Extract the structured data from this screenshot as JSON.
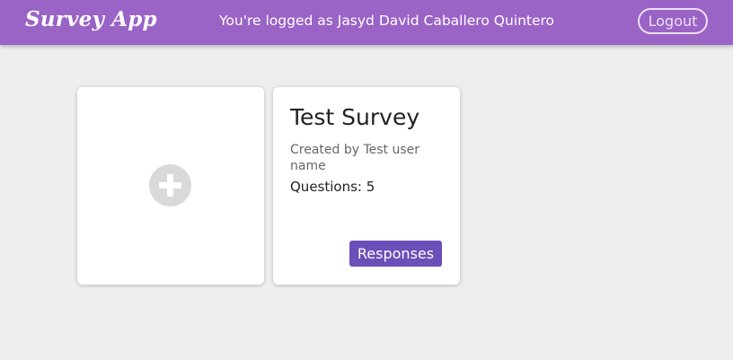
{
  "header": {
    "brand": "Survey App",
    "logged_as": "You're logged as Jasyd David Caballero Quintero",
    "logout_label": "Logout"
  },
  "colors": {
    "header_bg": "#9a63c6",
    "accent_button": "#6a50b8",
    "page_bg": "#eeeeee"
  },
  "cards": {
    "add_card": {
      "icon": "plus-circle-icon"
    },
    "survey": {
      "title": "Test Survey",
      "author": "Created by Test user name",
      "questions": "Questions: 5",
      "responses_label": "Responses"
    }
  }
}
